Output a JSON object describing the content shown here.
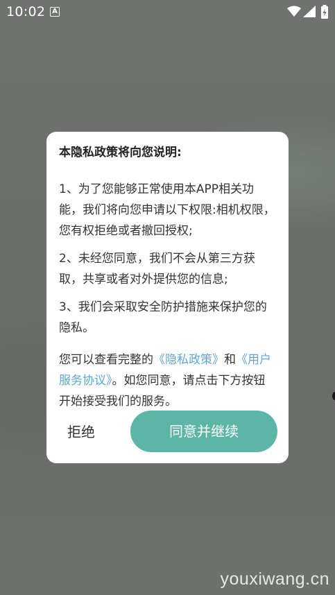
{
  "status_bar": {
    "time": "10:02",
    "notification_icon": "A"
  },
  "dialog": {
    "title": "本隐私政策将向您说明:",
    "paragraph1": "1、为了您能够正常使用本APP相关功能，我们将向您申请以下权限:相机权限，您有权拒绝或者撤回授权;",
    "paragraph2": "2、未经您同意，我们不会从第三方获取，共享或者对外提供您的信息;",
    "paragraph3": "3、我们会采取安全防护措施来保护您的隐私。",
    "paragraph4_prefix": "您可以查看完整的",
    "privacy_link": "《隐私政策》",
    "paragraph4_and": "和",
    "service_link": "《用户服务协议》",
    "paragraph4_suffix": "。如您同意，请点击下方按钮开始接受我们的服务。",
    "reject_label": "拒绝",
    "agree_label": "同意并继续",
    "accent_color": "#5bb6a6",
    "link_color": "#5ea7d6"
  },
  "watermark": "youxiwang.cn"
}
